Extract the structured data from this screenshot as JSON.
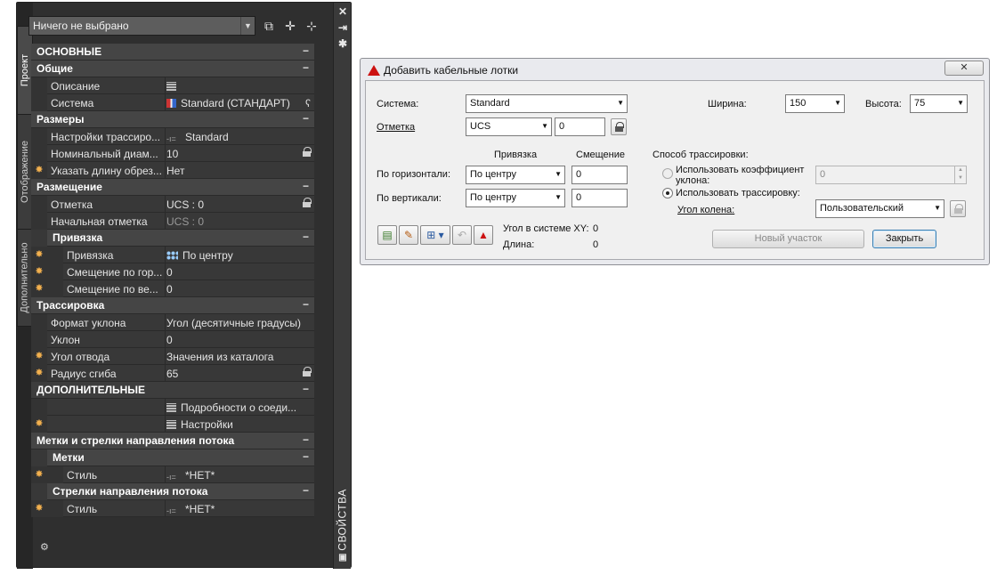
{
  "palette": {
    "vertical_tabs": [
      "Проект",
      "Отображение",
      "Дополнительно"
    ],
    "side_title": "СВОЙСТВА",
    "selection": "Ничего не выбрано",
    "rows": [
      {
        "kind": "section",
        "level": 0,
        "label": "ОСНОВНЫЕ",
        "toggle": "−"
      },
      {
        "kind": "section",
        "level": 0,
        "label": "Общие",
        "toggle": "−"
      },
      {
        "kind": "prop",
        "level": 0,
        "label": "Описание",
        "value": "",
        "icon": "grid-icon"
      },
      {
        "kind": "prop",
        "level": 0,
        "label": "Система",
        "value": "Standard (СТАНДАРТ)",
        "icon": "system-icon",
        "extra": "ʕ"
      },
      {
        "kind": "section",
        "level": 0,
        "label": "Размеры",
        "toggle": "−"
      },
      {
        "kind": "prop",
        "level": 0,
        "label": "Настройки трассиро...",
        "value": "Standard",
        "icon": "style-icon"
      },
      {
        "kind": "prop",
        "level": 0,
        "label": "Номинальный диам...",
        "value": "10",
        "lock": true
      },
      {
        "kind": "prop",
        "level": 0,
        "label": "Указать длину обрез...",
        "value": "Нет",
        "marker": "✸"
      },
      {
        "kind": "section",
        "level": 0,
        "label": "Размещение",
        "toggle": "−"
      },
      {
        "kind": "prop",
        "level": 0,
        "label": "Отметка",
        "value": "UCS : 0",
        "lock": true
      },
      {
        "kind": "prop",
        "level": 0,
        "label": "Начальная отметка",
        "value": "UCS : 0",
        "dim": true
      },
      {
        "kind": "section",
        "level": 1,
        "label": "Привязка",
        "toggle": "−"
      },
      {
        "kind": "prop",
        "level": 1,
        "label": "Привязка",
        "value": "По центру",
        "icon": "snap-icon",
        "marker": "✸"
      },
      {
        "kind": "prop",
        "level": 1,
        "label": "Смещение по гор...",
        "value": "0",
        "marker": "✸"
      },
      {
        "kind": "prop",
        "level": 1,
        "label": "Смещение по ве...",
        "value": "0",
        "marker": "✸"
      },
      {
        "kind": "section",
        "level": 0,
        "label": "Трассировка",
        "toggle": "−"
      },
      {
        "kind": "prop",
        "level": 0,
        "label": "Формат уклона",
        "value": "Угол (десятичные градусы)"
      },
      {
        "kind": "prop",
        "level": 0,
        "label": "Уклон",
        "value": "0"
      },
      {
        "kind": "prop",
        "level": 0,
        "label": "Угол отвода",
        "value": "Значения из каталога",
        "marker": "✸"
      },
      {
        "kind": "prop",
        "level": 0,
        "label": "Радиус сгиба",
        "value": "65",
        "marker": "✸",
        "lock": true
      },
      {
        "kind": "section",
        "level": 0,
        "label": "ДОПОЛНИТЕЛЬНЫЕ",
        "toggle": "−",
        "top": true
      },
      {
        "kind": "prop",
        "level": 0,
        "label": "",
        "value": "Подробности о соеди...",
        "icon": "grid-icon"
      },
      {
        "kind": "prop",
        "level": 0,
        "label": "",
        "value": "Настройки",
        "icon": "grid-icon",
        "marker": "✸"
      },
      {
        "kind": "section",
        "level": 0,
        "label": "Метки и стрелки направления потока",
        "toggle": "−"
      },
      {
        "kind": "section",
        "level": 1,
        "label": "Метки",
        "toggle": "−"
      },
      {
        "kind": "prop",
        "level": 1,
        "label": "Стиль",
        "value": "*НЕТ*",
        "icon": "style-icon",
        "marker": "✸"
      },
      {
        "kind": "section",
        "level": 1,
        "label": "Стрелки направления потока",
        "toggle": "−"
      },
      {
        "kind": "prop",
        "level": 1,
        "label": "Стиль",
        "value": "*НЕТ*",
        "icon": "style-icon",
        "marker": "✸"
      }
    ]
  },
  "dialog": {
    "title": "Добавить кабельные лотки",
    "close_glyph": "✕",
    "system_label": "Система:",
    "system_value": "Standard",
    "elevation_label": "Отметка",
    "elevation_ucs": "UCS",
    "elevation_value": "0",
    "width_label": "Ширина:",
    "width_value": "150",
    "height_label": "Высота:",
    "height_value": "75",
    "snap_header": "Привязка",
    "offset_header": "Смещение",
    "horizontal_label": "По горизонтали:",
    "horizontal_snap": "По центру",
    "horizontal_offset": "0",
    "vertical_label": "По вертикали:",
    "vertical_snap": "По центру",
    "vertical_offset": "0",
    "routing_method_label": "Способ трассировки:",
    "use_slope_label": "Использовать коэффициент уклона:",
    "slope_value": "0",
    "use_routing_label": "Использовать трассировку:",
    "elbow_angle_label": "Угол колена:",
    "elbow_angle_value": "Пользовательский",
    "xy_angle_label": "Угол в системе XY:",
    "xy_angle_value": "0",
    "length_label": "Длина:",
    "length_value": "0",
    "new_segment_button": "Новый участок",
    "close_button": "Закрыть"
  }
}
